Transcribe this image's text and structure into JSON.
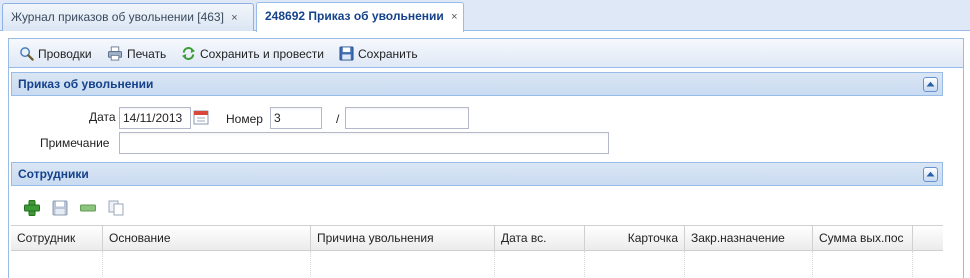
{
  "tabs": [
    {
      "label": "Журнал приказов об увольнении [463]",
      "close": "×"
    },
    {
      "label": "248692 Приказ об увольнении",
      "close": "×"
    }
  ],
  "toolbar": {
    "postings": "Проводки",
    "print": "Печать",
    "save_post": "Сохранить и провести",
    "save": "Сохранить"
  },
  "order": {
    "title": "Приказ об увольнении",
    "date_label": "Дата",
    "date_value": "14/11/2013",
    "number_label": "Номер",
    "number_value": "3",
    "slash": "/",
    "number_suffix": "",
    "note_label": "Примечание",
    "note_value": ""
  },
  "employees": {
    "title": "Сотрудники",
    "columns": [
      "Сотрудник",
      "Основание",
      "Причина увольнения",
      "Дата вс.",
      "Карточка",
      "Закр.назначение",
      "Сумма вых.пос"
    ]
  },
  "colors": {
    "header_text": "#15428b",
    "border": "#99bbe8",
    "tab_bg": "#dfe8f6"
  }
}
